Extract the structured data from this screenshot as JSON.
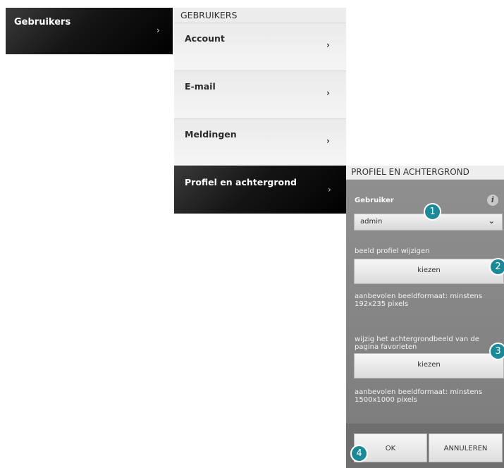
{
  "sidebar": {
    "items": [
      {
        "label": "Gebruikers",
        "chevron": "›"
      }
    ]
  },
  "users_menu": {
    "header": "GEBRUIKERS",
    "items": [
      {
        "label": "Account",
        "chevron": "›"
      },
      {
        "label": "E-mail",
        "chevron": "›"
      },
      {
        "label": "Meldingen",
        "chevron": "›"
      },
      {
        "label": "Profiel en achtergrond",
        "chevron": "›",
        "selected": true
      }
    ]
  },
  "profile_panel": {
    "header": "PROFIEL EN ACHTERGROND",
    "user_label": "Gebruiker",
    "info_icon": "i",
    "user_select_value": "admin",
    "dropdown_icon": "⌄",
    "change_profile_label": "beeld profiel wijzigen",
    "choose_button_1": "kiezen",
    "recommend_1": "aanbevolen beeldformaat: minstens 192x235 pixels",
    "change_bg_label": "wijzig het achtergrondbeeld van de pagina favorieten",
    "choose_button_2": "kiezen",
    "recommend_2": "aanbevolen beeldformaat: minstens 1500x1000 pixels",
    "ok_button": "OK",
    "cancel_button": "ANNULEREN"
  },
  "badges": [
    "1",
    "2",
    "3",
    "4"
  ],
  "colors": {
    "badge": "#1a8a99",
    "panel_bg": "#878787",
    "dark_item": "#111111"
  }
}
